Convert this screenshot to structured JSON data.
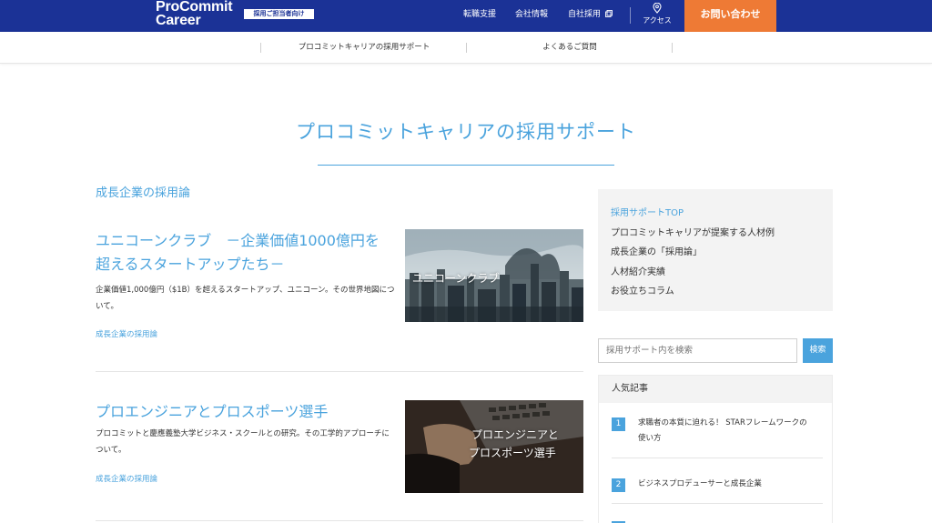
{
  "header": {
    "logo_line1": "ProCommit",
    "logo_line2": "Career",
    "logo_badge": "採用ご担当者向け",
    "nav": [
      "転職支援",
      "会社情報",
      "自社採用"
    ],
    "access_label": "アクセス",
    "contact_label": "お問い合わせ",
    "colors": {
      "bar": "#1b3296",
      "contact": "#ee7a35"
    }
  },
  "subnav": {
    "items": [
      "プロコミットキャリアの採用サポート",
      "よくあるご質問"
    ]
  },
  "page": {
    "title": "プロコミットキャリアの採用サポート",
    "category": "成長企業の採用論",
    "accent": "#4aa3dd"
  },
  "articles": [
    {
      "title": "ユニコーンクラブ　－企業価値1000億円を超えるスタートアップたち－",
      "description": "企業価値1,000億円（$1B）を超えるスタートアップ、ユニコーン。その世界地図について。",
      "category": "成長企業の採用論",
      "thumb_text": "ユニコーンクラブ"
    },
    {
      "title": "プロエンジニアとプロスポーツ選手",
      "description": "プロコミットと慶應義塾大学ビジネス・スクールとの研究。その工学的アプローチについて。",
      "category": "成長企業の採用論",
      "thumb_text_line1": "プロエンジニアと",
      "thumb_text_line2": "プロスポーツ選手"
    }
  ],
  "sidebar": {
    "menu": [
      "採用サポートTOP",
      "プロコミットキャリアが提案する人材例",
      "成長企業の「採用論」",
      "人材紹介実績",
      "お役立ちコラム"
    ],
    "search_placeholder": "採用サポート内を検索",
    "search_button": "検索",
    "popular_heading": "人気記事",
    "popular": [
      {
        "rank": "1",
        "title": "求職者の本質に迫れる！ STARフレームワークの使い方"
      },
      {
        "rank": "2",
        "title": "ビジネスプロデューサーと成長企業"
      }
    ]
  }
}
